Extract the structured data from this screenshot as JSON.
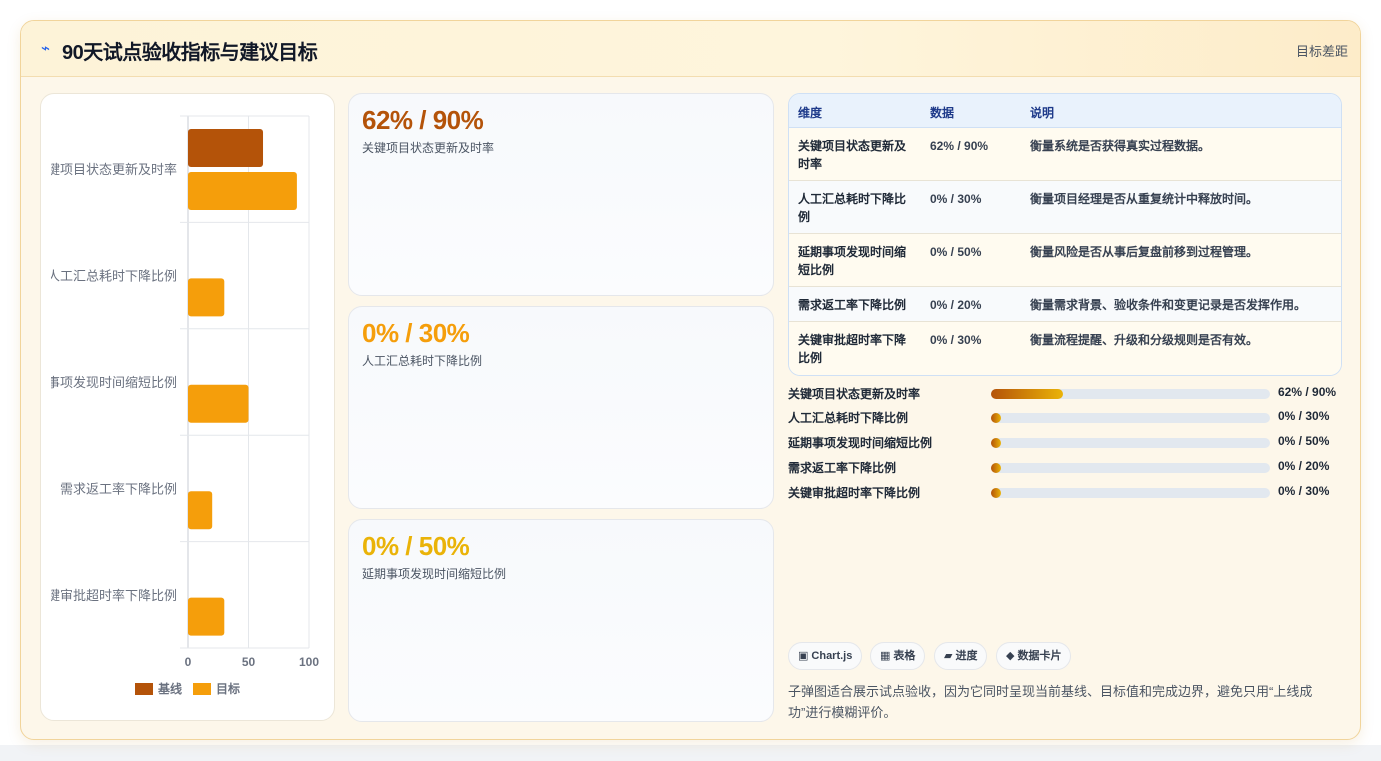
{
  "header": {
    "icon": "⌁",
    "title": "90天试点验收指标与建议目标",
    "tag": "目标差距"
  },
  "colors": {
    "baseline": "#b45309",
    "target": "#f59e0b",
    "stat_value_1": "#b45309",
    "stat_value_2": "#f59e0b",
    "stat_value_3": "#eab308"
  },
  "chart_data": {
    "type": "bar",
    "orientation": "horizontal",
    "categories": [
      "关键项目状态更新及时率",
      "人工汇总耗时下降比例",
      "延期事项发现时间缩短比例",
      "需求返工率下降比例",
      "关键审批超时率下降比例"
    ],
    "series": [
      {
        "name": "基线",
        "values": [
          62,
          0,
          0,
          0,
          0
        ]
      },
      {
        "name": "目标",
        "values": [
          90,
          30,
          50,
          20,
          30
        ]
      }
    ],
    "xlim": [
      0,
      100
    ],
    "xticks": [
      "0",
      "50",
      "100"
    ],
    "grid": true,
    "legend": "bottom"
  },
  "stat_cards": [
    {
      "value": "62% / 90%",
      "label": "关键项目状态更新及时率"
    },
    {
      "value": "0% / 30%",
      "label": "人工汇总耗时下降比例"
    },
    {
      "value": "0% / 50%",
      "label": "延期事项发现时间缩短比例"
    }
  ],
  "table": {
    "headers": [
      "维度",
      "数据",
      "说明"
    ],
    "rows": [
      {
        "name": "关键项目状态更新及时率",
        "value": "62% / 90%",
        "desc": "衡量系统是否获得真实过程数据。"
      },
      {
        "name": "人工汇总耗时下降比例",
        "value": "0% / 30%",
        "desc": "衡量项目经理是否从重复统计中释放时间。"
      },
      {
        "name": "延期事项发现时间缩短比例",
        "value": "0% / 50%",
        "desc": "衡量风险是否从事后复盘前移到过程管理。"
      },
      {
        "name": "需求返工率下降比例",
        "value": "0% / 20%",
        "desc": "衡量需求背景、验收条件和变更记录是否发挥作用。"
      },
      {
        "name": "关键审批超时率下降比例",
        "value": "0% / 30%",
        "desc": "衡量流程提醒、升级和分级规则是否有效。"
      }
    ]
  },
  "progress": [
    {
      "label": "关键项目状态更新及时率",
      "value": "62% / 90%",
      "fraction": 0.2585
    },
    {
      "label": "人工汇总耗时下降比例",
      "value": "0% / 30%",
      "fraction": 0
    },
    {
      "label": "延期事项发现时间缩短比例",
      "value": "0% / 50%",
      "fraction": 0
    },
    {
      "label": "需求返工率下降比例",
      "value": "0% / 20%",
      "fraction": 0
    },
    {
      "label": "关键审批超时率下降比例",
      "value": "0% / 30%",
      "fraction": 0
    }
  ],
  "tags": [
    {
      "icon": "▣",
      "icon_name": "chart-icon",
      "label": "Chart.js"
    },
    {
      "icon": "▦",
      "icon_name": "table-icon",
      "label": "表格"
    },
    {
      "icon": "▰",
      "icon_name": "progress-icon",
      "label": "进度"
    },
    {
      "icon": "◆",
      "icon_name": "data-card-icon",
      "label": "数据卡片"
    }
  ],
  "footnote": "子弹图适合展示试点验收，因为它同时呈现当前基线、目标值和完成边界，避免只用“上线成功”进行模糊评价。"
}
